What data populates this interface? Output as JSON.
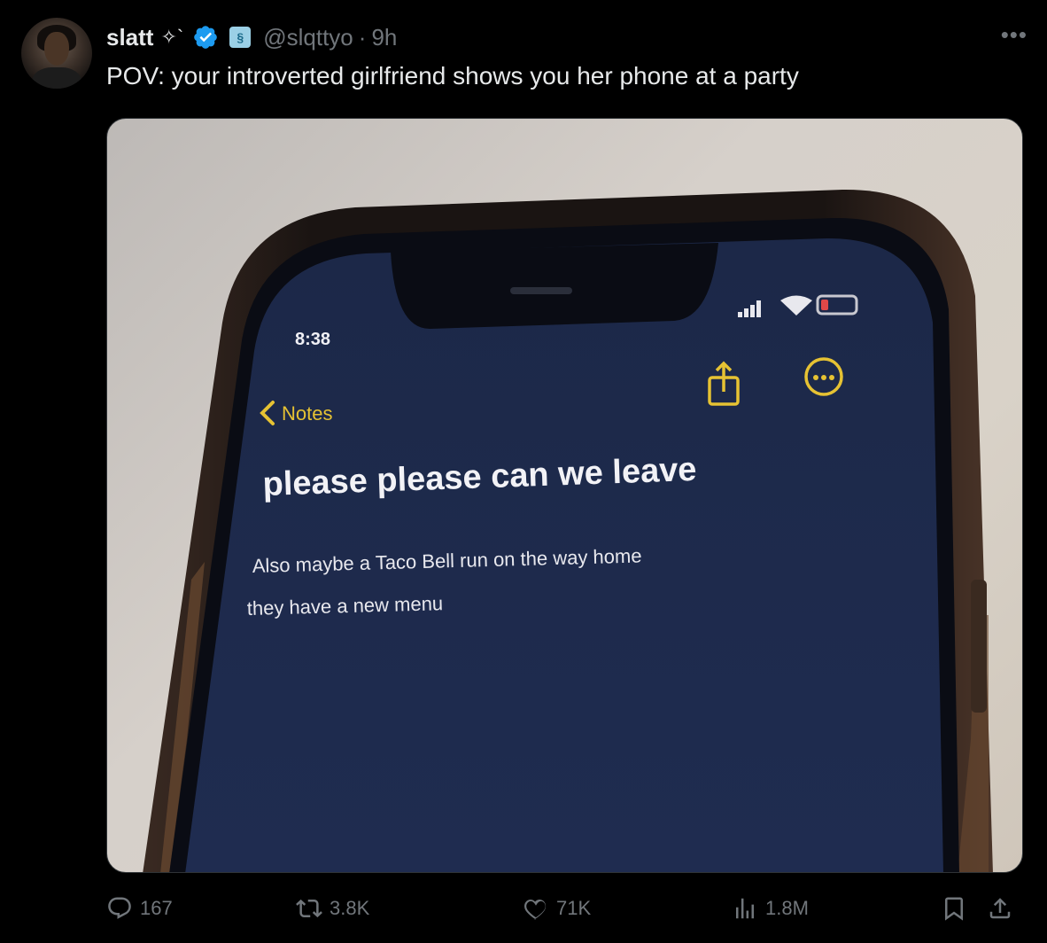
{
  "author": {
    "name": "slatt",
    "name_suffix": "✧`",
    "handle": "@slqttyo",
    "separator": "·",
    "time": "9h"
  },
  "tweet": {
    "text": "POV: your introverted girlfriend shows you her phone at a party"
  },
  "media": {
    "phone_time": "8:38",
    "back_label": "Notes",
    "note_title": "please please can we leave",
    "note_line1": "Also maybe a Taco Bell run on the way home",
    "note_line2": "they have a new menu"
  },
  "actions": {
    "replies": "167",
    "reposts": "3.8K",
    "likes": "71K",
    "views": "1.8M"
  },
  "colors": {
    "background": "#000000",
    "text": "#e7e9ea",
    "muted": "#71767b",
    "verified": "#1d9bf0",
    "screen": "#1e2a4a",
    "notes_accent": "#e6c233"
  }
}
